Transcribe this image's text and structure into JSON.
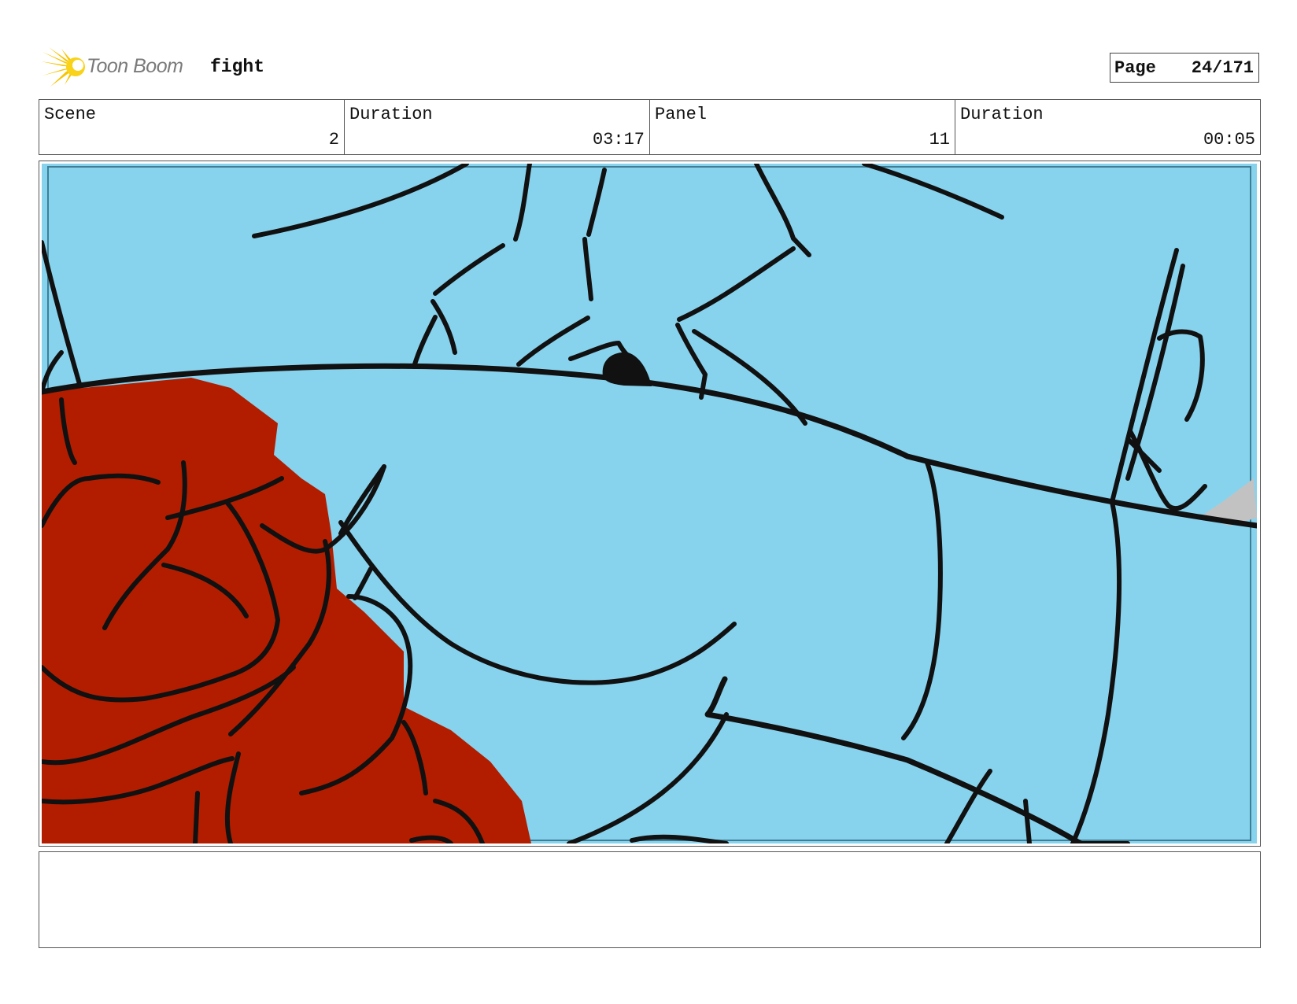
{
  "header": {
    "logo_icon": "toon-boom-star-icon",
    "logo_text": "Toon Boom",
    "project_title": "fight",
    "page_label": "Page",
    "page_value": "24/171"
  },
  "info": {
    "scene_label": "Scene",
    "scene_value": "2",
    "scene_duration_label": "Duration",
    "scene_duration_value": "03:17",
    "panel_label": "Panel",
    "panel_value": "11",
    "panel_duration_label": "Duration",
    "panel_duration_value": "00:05"
  },
  "colors": {
    "sky_blue": "#87d3ee",
    "glove_red": "#b21d00",
    "line_black": "#111111",
    "logo_yellow": "#f7c400"
  },
  "notes": ""
}
